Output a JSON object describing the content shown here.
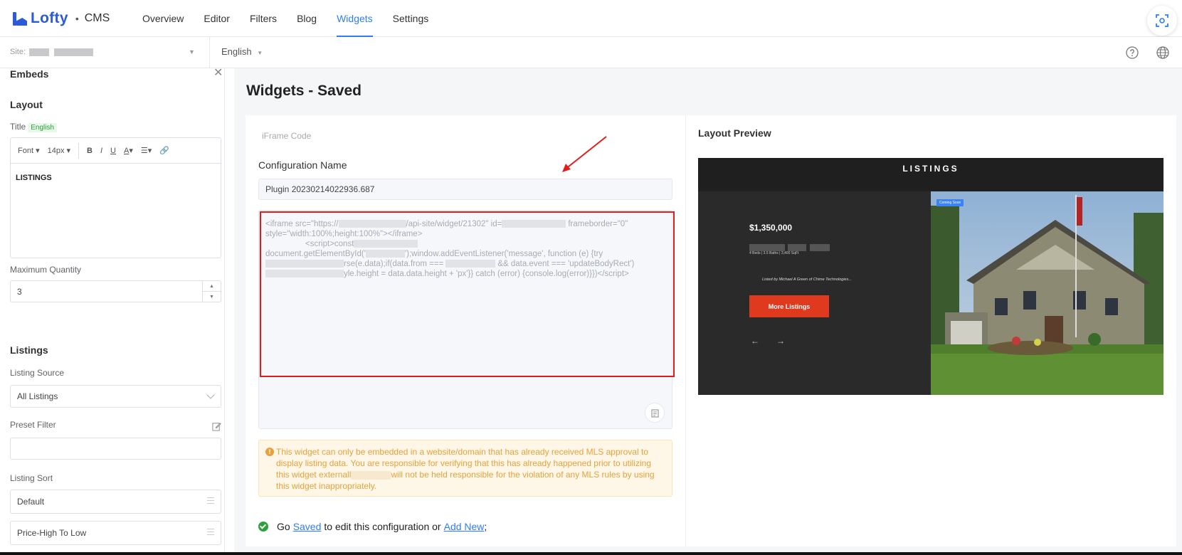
{
  "app": {
    "brand": "Lofty",
    "product": "CMS",
    "accent": "#2f7df6",
    "logo_color": "#2c5bd8"
  },
  "nav": {
    "items": [
      {
        "label": "Overview"
      },
      {
        "label": "Editor"
      },
      {
        "label": "Filters"
      },
      {
        "label": "Blog"
      },
      {
        "label": "Widgets"
      },
      {
        "label": "Settings"
      }
    ],
    "active": "Widgets"
  },
  "subbar": {
    "site_label": "Site:",
    "language": "English"
  },
  "left_panel": {
    "title": "Embeds",
    "layout_section": "Layout",
    "title_field_label": "Title",
    "title_lang_tag": "English",
    "editor_toolbar": {
      "font": "Font",
      "size": "14px",
      "bold": "B",
      "italic": "I",
      "underline": "U",
      "color": "A"
    },
    "editor_content": "LISTINGS",
    "max_quantity_label": "Maximum Quantity",
    "max_quantity_value": "3",
    "listings_section": "Listings",
    "listing_source_label": "Listing Source",
    "listing_source_value": "All Listings",
    "preset_filter_label": "Preset Filter",
    "preset_filter_value": "",
    "listing_sort_label": "Listing Sort",
    "sort_options": [
      "Default",
      "Price-High To Low"
    ]
  },
  "main": {
    "page_title": "Widgets - Saved",
    "iframe_tab": "iFrame Code",
    "config_name_label": "Configuration Name",
    "config_name_value": "Plugin 20230214022936.687",
    "code": {
      "line1a": "<iframe src=\"https://",
      "line1b": "/api-site/widget/21302\" id=",
      "line1c": "frameborder=\"0\"",
      "line2": "style=\"width:100%;height:100%\"></iframe>",
      "line3": "<script>const",
      "line4a": "document.getElementById('",
      "line4b": "');window.addEventListener('message', function (e) {try",
      "line5a": "rse(e.data);if(data.from ===",
      "line5b": "&& data.event === 'updateBodyRect')",
      "line6": "yle.height = data.data.height + 'px'}} catch (error) {console.log(error)}})</script>"
    },
    "warning_a": "This widget can only be embedded in a website/domain that has already received MLS approval to display listing data. You are responsible for verifying that this has already happened prior to utilizing this widget externall",
    "warning_b": "will not be held responsible for the violation of any MLS rules by using this widget inappropriately.",
    "go_prefix": "Go",
    "go_saved": "Saved",
    "go_middle": "to edit this configuration or",
    "go_add_new": "Add New",
    "go_suffix": ";",
    "preview_label": "Layout Preview",
    "preview": {
      "header": "LISTINGS",
      "price": "$1,350,000",
      "details": "4 Beds  |  3.5 Baths  |  3,400 SqFt",
      "listed_by": "Listed by  Michael A Green of Chime Technologies...",
      "more_button": "More Listings",
      "badge": "Coming Soon"
    }
  }
}
